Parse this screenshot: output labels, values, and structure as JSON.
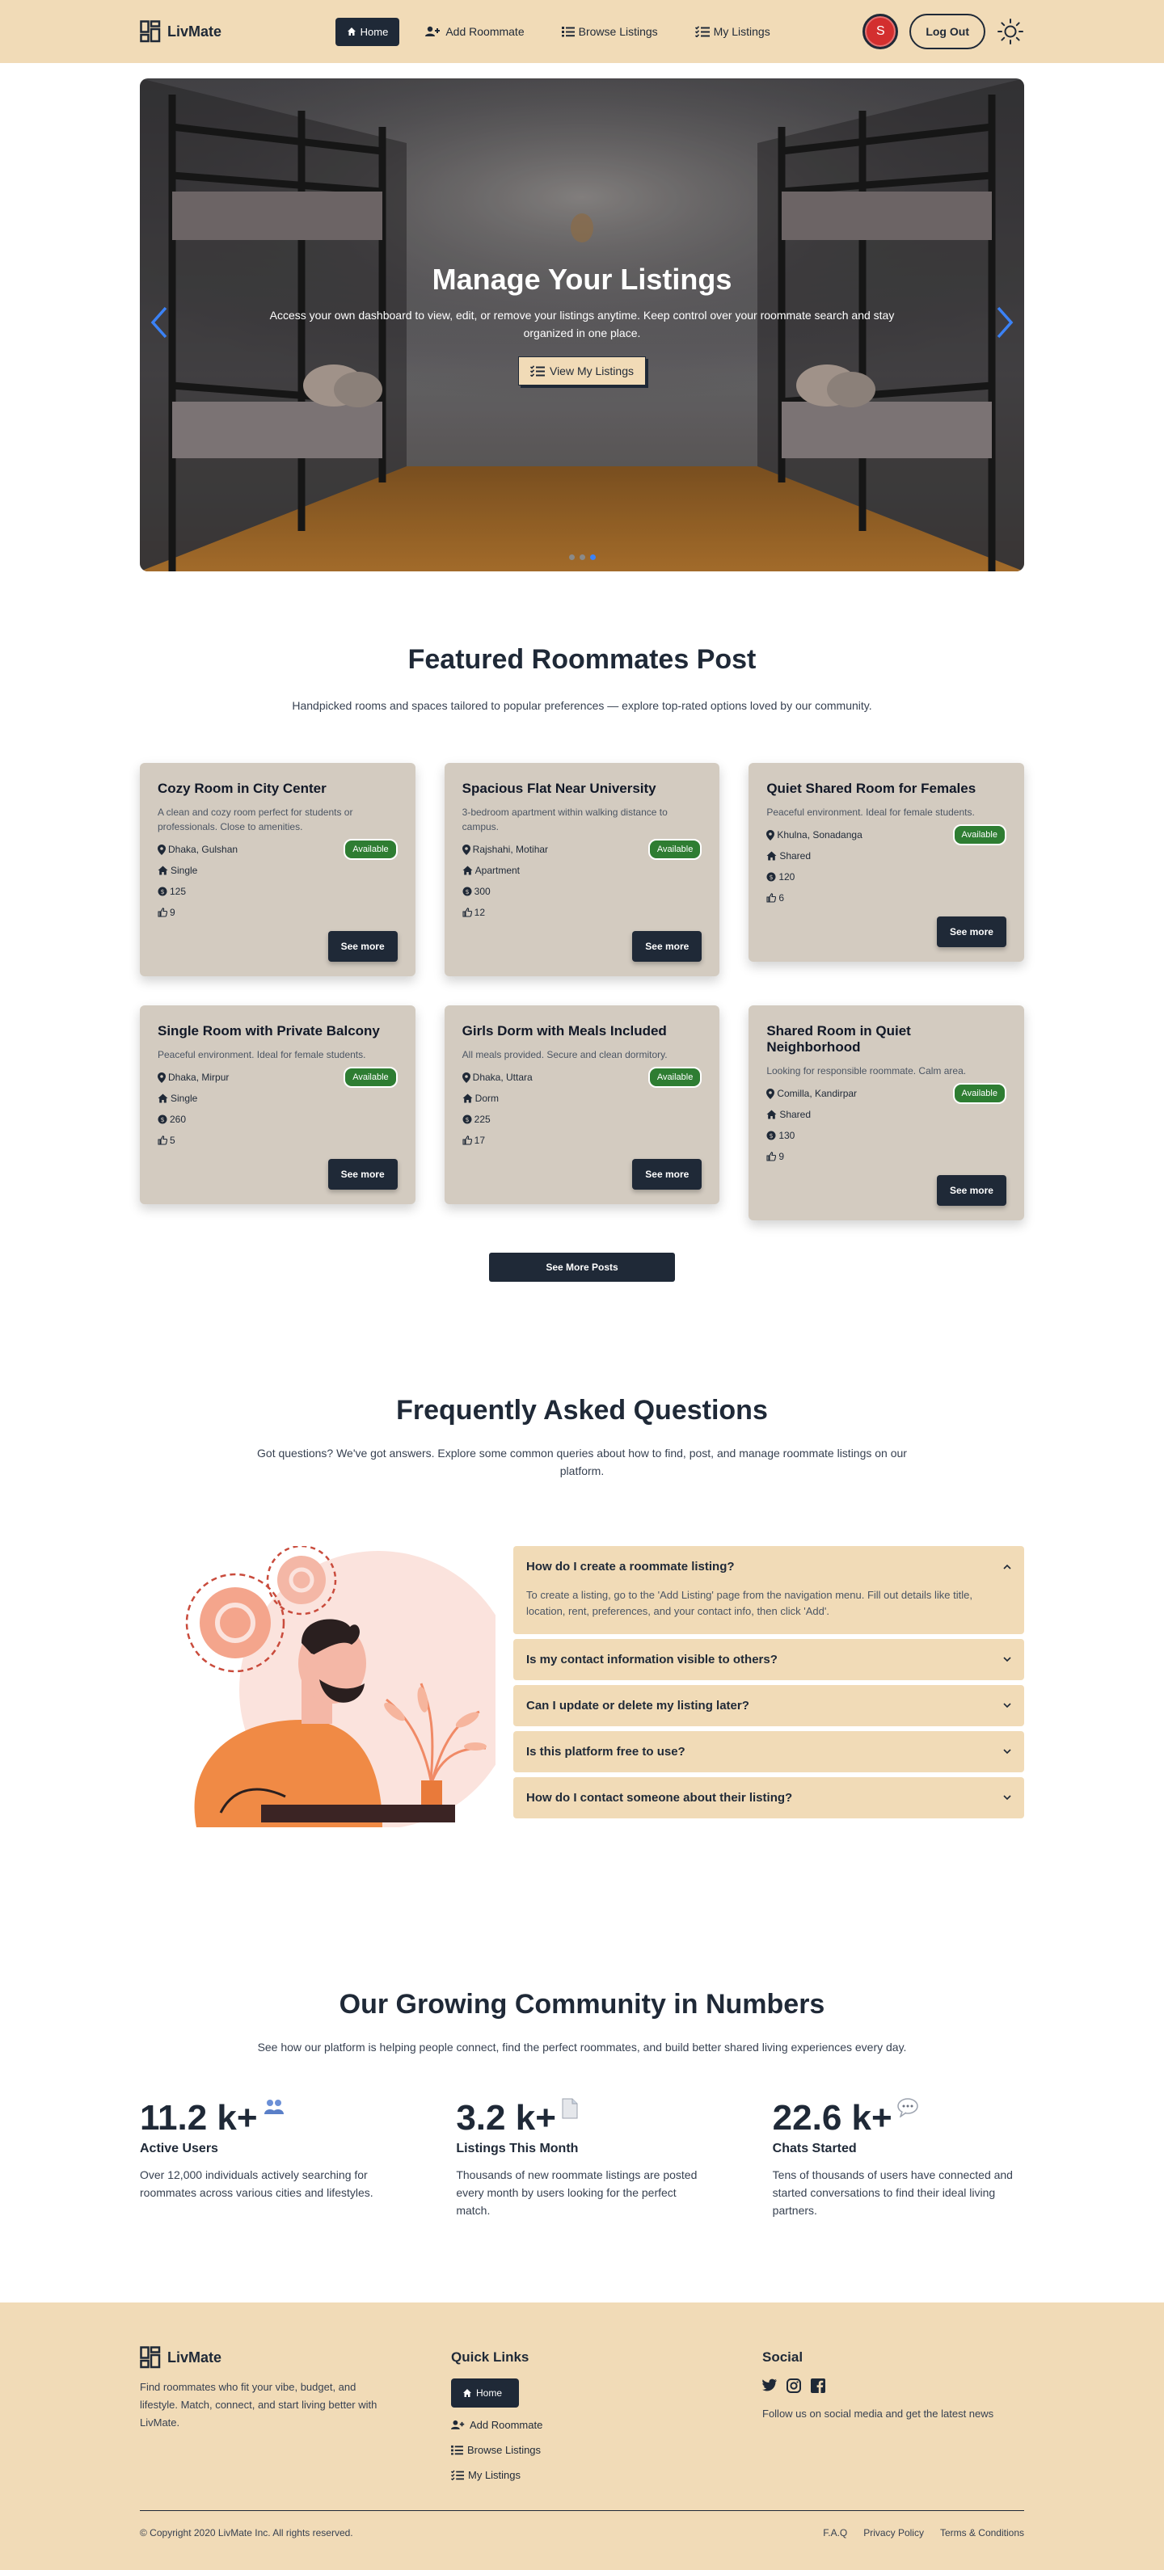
{
  "nav": {
    "brand": "LivMate",
    "links": [
      {
        "label": "Home",
        "icon": "home-icon"
      },
      {
        "label": "Add Roommate",
        "icon": "add-user-icon"
      },
      {
        "label": "Browse Listings",
        "icon": "list-icon"
      },
      {
        "label": "My Listings",
        "icon": "checklist-icon"
      }
    ],
    "avatar_initial": "S",
    "logout_label": "Log Out"
  },
  "hero": {
    "title": "Manage Your Listings",
    "subtitle": "Access your own dashboard to view, edit, or remove your listings anytime. Keep control over your roommate search and stay organized in one place.",
    "button_label": "View My Listings",
    "active_slide": 3,
    "slide_count": 3
  },
  "featured": {
    "title": "Featured Roommates Post",
    "subtitle": "Handpicked rooms and spaces tailored to popular preferences — explore top-rated options loved by our community.",
    "see_more_label": "See more",
    "more_posts_label": "See More Posts",
    "cards": [
      {
        "title": "Cozy Room in City Center",
        "desc": "A clean and cozy room perfect for students or professionals. Close to amenities.",
        "location": "Dhaka, Gulshan",
        "status": "Available",
        "type": "Single",
        "rent": "125",
        "likes": "9"
      },
      {
        "title": "Spacious Flat Near University",
        "desc": "3-bedroom apartment within walking distance to campus.",
        "location": "Rajshahi, Motihar",
        "status": "Available",
        "type": "Apartment",
        "rent": "300",
        "likes": "12"
      },
      {
        "title": "Quiet Shared Room for Females",
        "desc": "Peaceful environment. Ideal for female students.",
        "location": "Khulna, Sonadanga",
        "status": "Available",
        "type": "Shared",
        "rent": "120",
        "likes": "6"
      },
      {
        "title": "Single Room with Private Balcony",
        "desc": "Peaceful environment. Ideal for female students.",
        "location": "Dhaka, Mirpur",
        "status": "Available",
        "type": "Single",
        "rent": "260",
        "likes": "5"
      },
      {
        "title": "Girls Dorm with Meals Included",
        "desc": "All meals provided. Secure and clean dormitory.",
        "location": "Dhaka, Uttara",
        "status": "Available",
        "type": "Dorm",
        "rent": "225",
        "likes": "17"
      },
      {
        "title": "Shared Room in Quiet Neighborhood",
        "desc": "Looking for responsible roommate. Calm area.",
        "location": "Comilla, Kandirpar",
        "status": "Available",
        "type": "Shared",
        "rent": "130",
        "likes": "9"
      }
    ]
  },
  "faq": {
    "title": "Frequently Asked Questions",
    "subtitle": "Got questions? We've got answers. Explore some common queries about how to find, post, and manage roommate listings on our platform.",
    "items": [
      {
        "q": "How do I create a roommate listing?",
        "a": "To create a listing, go to the 'Add Listing' page from the navigation menu. Fill out details like title, location, rent, preferences, and your contact info, then click 'Add'.",
        "open": true
      },
      {
        "q": "Is my contact information visible to others?",
        "a": "",
        "open": false
      },
      {
        "q": "Can I update or delete my listing later?",
        "a": "",
        "open": false
      },
      {
        "q": "Is this platform free to use?",
        "a": "",
        "open": false
      },
      {
        "q": "How do I contact someone about their listing?",
        "a": "",
        "open": false
      }
    ]
  },
  "stats": {
    "title": "Our Growing Community in Numbers",
    "subtitle": "See how our platform is helping people connect, find the perfect roommates, and build better shared living experiences every day.",
    "items": [
      {
        "value": "11.2 k+",
        "icon": "users-icon",
        "label": "Active Users",
        "desc": "Over 12,000 individuals actively searching for roommates across various cities and lifestyles."
      },
      {
        "value": "3.2 k+",
        "icon": "document-icon",
        "label": "Listings This Month",
        "desc": "Thousands of new roommate listings are posted every month by users looking for the perfect match."
      },
      {
        "value": "22.6 k+",
        "icon": "chat-bubble-icon",
        "label": "Chats Started",
        "desc": "Tens of thousands of users have connected and started conversations to find their ideal living partners."
      }
    ]
  },
  "footer": {
    "brand": "LivMate",
    "desc": "Find roommates who fit your vibe, budget, and lifestyle. Match, connect, and start living better with LivMate.",
    "quick_links_title": "Quick Links",
    "links": [
      "Home",
      "Add Roommate",
      "Browse Listings",
      "My Listings"
    ],
    "social_title": "Social",
    "social_icons": [
      "twitter-icon",
      "instagram-icon",
      "facebook-icon"
    ],
    "follow_text": "Follow us on social media and get the latest news",
    "copyright": "© Copyright 2020 LivMate Inc. All rights reserved.",
    "legal": [
      "F.A.Q",
      "Privacy Policy",
      "Terms & Conditions"
    ]
  },
  "colors": {
    "accent_beige": "#f1dbb7",
    "dark": "#1f2937",
    "card_bg": "#d3cbc0",
    "available_green": "#2e7d32",
    "avatar_red": "#d32f2f",
    "slider_blue": "#3b82f6"
  }
}
